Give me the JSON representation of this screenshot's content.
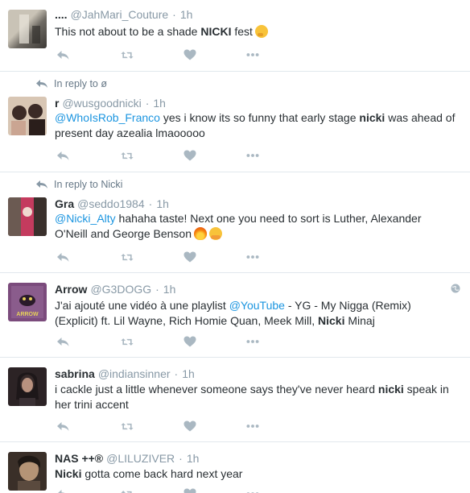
{
  "tweets": [
    {
      "reply_context": "",
      "name": "....",
      "handle": "@JahMari_Couture",
      "time": "1h",
      "body_segments": [
        {
          "t": "This not about to be a shade "
        },
        {
          "t": "NICKI",
          "b": true
        },
        {
          "t": " fest"
        }
      ],
      "emojis": [
        "thinking-face"
      ],
      "avatar_colors": [
        "#6e6a63",
        "#c9c3b6"
      ]
    },
    {
      "reply_context": "In reply to ø",
      "name": "r",
      "handle": "@wusgoodnicki",
      "time": "1h",
      "body_segments": [
        {
          "t": "@WhoIsRob_Franco",
          "m": true
        },
        {
          "t": " yes i know its so funny that early stage "
        },
        {
          "t": "nicki",
          "b": true
        },
        {
          "t": " was ahead of present day azealia lmaooooo"
        }
      ],
      "emojis": [],
      "avatar_colors": [
        "#caa592",
        "#3b2a26"
      ]
    },
    {
      "reply_context": "In reply to Nicki",
      "name": "Gra",
      "handle": "@seddo1984",
      "time": "1h",
      "body_segments": [
        {
          "t": "@Nicki_Alty",
          "m": true
        },
        {
          "t": " hahaha taste! Next one you need to sort is Luther, Alexander O'Neill and George Benson"
        }
      ],
      "emojis": [
        "fire",
        "hugging-face"
      ],
      "avatar_colors": [
        "#4a3e3a",
        "#c43b5e"
      ]
    },
    {
      "reply_context": "",
      "name": "Arrow",
      "handle": "@G3DOGG",
      "time": "1h",
      "body_segments": [
        {
          "t": "J'ai ajouté une vidéo à une playlist "
        },
        {
          "t": "@YouTube",
          "m": true
        },
        {
          "t": " - YG - My Nigga (Remix) (Explicit) ft. Lil Wayne, Rich Homie Quan, Meek Mill, "
        },
        {
          "t": "Nicki",
          "b": true
        },
        {
          "t": " Minaj"
        }
      ],
      "emojis": [],
      "avatar_colors": [
        "#7b4b7c",
        "#e6d05a"
      ],
      "avatar_text": "ARROW"
    },
    {
      "reply_context": "",
      "name": "sabrina",
      "handle": "@indiansinner",
      "time": "1h",
      "body_segments": [
        {
          "t": "i cackle just a little whenever someone says they've never heard "
        },
        {
          "t": "nicki",
          "b": true
        },
        {
          "t": " speak in her trini accent"
        }
      ],
      "emojis": [],
      "avatar_colors": [
        "#2c2325",
        "#a78277"
      ]
    },
    {
      "reply_context": "",
      "name": "NAS ++®",
      "handle": "@LILUZIVER",
      "time": "1h",
      "body_segments": [
        {
          "t": "Nicki",
          "b": true
        },
        {
          "t": " gotta come back hard next year"
        }
      ],
      "emojis": [],
      "avatar_colors": [
        "#3a2f28",
        "#b59476"
      ]
    }
  ],
  "colors": {
    "link": "#1b95e0",
    "meta": "#8899a6",
    "icon": "#aab8c2",
    "divider": "#e1e8ed"
  }
}
